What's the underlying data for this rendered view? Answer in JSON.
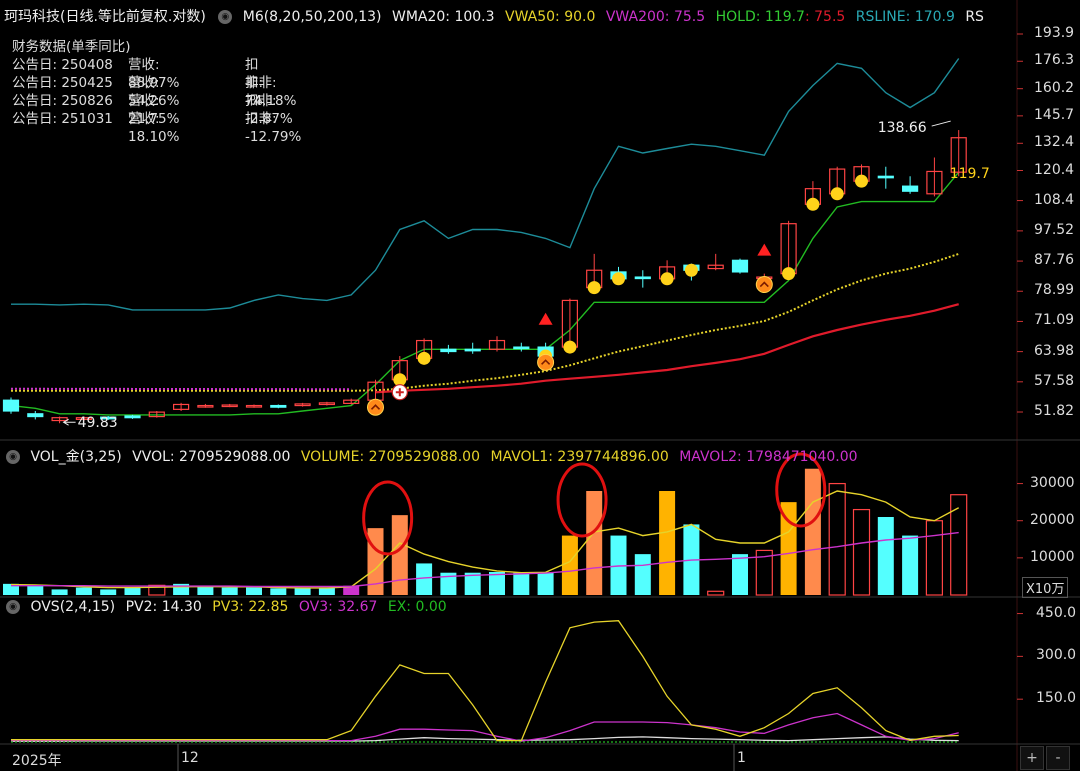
{
  "header": {
    "title": "珂玛科技(日线.等比前复权.对数)",
    "m6": "M6(8,20,50,200,13)",
    "wma20": "WMA20: 100.3",
    "vwa50": "VWA50: 90.0",
    "vwa200": "VWA200: 75.5",
    "hold_a": "HOLD: 119.7",
    "hold_b": ": 75.5",
    "rsline": "RSLINE: 170.9",
    "rs": "RS"
  },
  "financials": {
    "title": "财务数据(单季同比)",
    "rows": [
      {
        "date": "公告日: 250408",
        "rev": "营收: 88.97%",
        "np": "扣非: -%"
      },
      {
        "date": "公告日: 250425",
        "rev": "营收: 54.26%",
        "np": "扣非: 74.18%"
      },
      {
        "date": "公告日: 250826",
        "rev": "营收: 21.75%",
        "np": "扣非: -2.87%"
      },
      {
        "date": "公告日: 251031",
        "rev": "营收: 18.10%",
        "np": "扣非: -12.79%"
      }
    ]
  },
  "price_axis": [
    "193.9",
    "176.3",
    "160.2",
    "145.7",
    "132.4",
    "120.4",
    "108.4",
    "97.52",
    "87.76",
    "78.99",
    "71.09",
    "63.98",
    "57.58",
    "51.82"
  ],
  "annotations": {
    "high": "138.66",
    "low": "49.83",
    "last": "119.7"
  },
  "volume_panel": {
    "name": "VOL_金(3,25)",
    "vvol": "VVOL: 2709529088.00",
    "volume": "VOLUME: 2709529088.00",
    "mavol1": "MAVOL1: 2397744896.00",
    "mavol2": "MAVOL2: 1798471040.00",
    "axis": [
      "30000",
      "20000",
      "10000"
    ],
    "unit": "X10万"
  },
  "ovs_panel": {
    "name": "OVS(2,4,15)",
    "pv2": "PV2: 14.30",
    "pv3": "PV3: 22.85",
    "ov3": "OV3: 32.67",
    "ex": "EX: 0.00",
    "axis": [
      "450.0",
      "300.0",
      "150.0"
    ]
  },
  "time_axis": [
    "2025年",
    "12",
    "1"
  ],
  "buttons": {
    "plus": "+",
    "minus": "-"
  },
  "colors": {
    "up": "#ff4444",
    "down": "#54ffff",
    "yellow": "#e6d32a",
    "magenta": "#cc33cc",
    "green": "#22bb22",
    "teal": "#1d8c99",
    "red_line": "#e01b2b",
    "orange": "#ff8a4c",
    "gold": "#ffb300"
  },
  "chart_data": [
    {
      "type": "candlestick",
      "title": "珂玛科技(日线.等比前复权.对数)",
      "y_scale": "log",
      "ylim": [
        49.83,
        193.9
      ],
      "candles": [
        {
          "o": 52,
          "c": 54,
          "h": 54.5,
          "l": 51.5,
          "dir": "down"
        },
        {
          "o": 51,
          "c": 51.5,
          "h": 52,
          "l": 50.5,
          "dir": "down"
        },
        {
          "o": 50.3,
          "c": 50.8,
          "h": 51,
          "l": 49.83,
          "dir": "up"
        },
        {
          "o": 50.5,
          "c": 50.8,
          "h": 51,
          "l": 50.2,
          "dir": "up"
        },
        {
          "o": 50.6,
          "c": 50.9,
          "h": 51.1,
          "l": 50.4,
          "dir": "down"
        },
        {
          "o": 50.8,
          "c": 51.1,
          "h": 51.3,
          "l": 50.6,
          "dir": "down"
        },
        {
          "o": 51,
          "c": 51.8,
          "h": 52,
          "l": 50.8,
          "dir": "up"
        },
        {
          "o": 52.3,
          "c": 53.2,
          "h": 53.5,
          "l": 52,
          "dir": "up"
        },
        {
          "o": 52.8,
          "c": 53,
          "h": 53.3,
          "l": 52.6,
          "dir": "up"
        },
        {
          "o": 52.9,
          "c": 53.1,
          "h": 53.3,
          "l": 52.7,
          "dir": "up"
        },
        {
          "o": 53,
          "c": 52.8,
          "h": 53.2,
          "l": 52.6,
          "dir": "up"
        },
        {
          "o": 53,
          "c": 52.7,
          "h": 53.2,
          "l": 52.5,
          "dir": "down"
        },
        {
          "o": 53,
          "c": 53.3,
          "h": 53.5,
          "l": 52.8,
          "dir": "up"
        },
        {
          "o": 53.2,
          "c": 53.5,
          "h": 53.7,
          "l": 53,
          "dir": "up"
        },
        {
          "o": 53.4,
          "c": 54,
          "h": 54.3,
          "l": 53.2,
          "dir": "up"
        },
        {
          "o": 54,
          "c": 57.5,
          "h": 58,
          "l": 53.8,
          "dir": "up"
        },
        {
          "o": 58,
          "c": 62,
          "h": 63,
          "l": 57.5,
          "dir": "up"
        },
        {
          "o": 62.5,
          "c": 66.5,
          "h": 67,
          "l": 62,
          "dir": "up"
        },
        {
          "o": 64.5,
          "c": 64,
          "h": 65.5,
          "l": 63.5,
          "dir": "down"
        },
        {
          "o": 64.5,
          "c": 64.5,
          "h": 66,
          "l": 63.5,
          "dir": "down"
        },
        {
          "o": 64.5,
          "c": 66.5,
          "h": 67.5,
          "l": 64,
          "dir": "up"
        },
        {
          "o": 65,
          "c": 65,
          "h": 66,
          "l": 64,
          "dir": "down"
        },
        {
          "o": 65,
          "c": 63,
          "h": 66,
          "l": 62.5,
          "dir": "down"
        },
        {
          "o": 65,
          "c": 76.5,
          "h": 77,
          "l": 64.5,
          "dir": "up"
        },
        {
          "o": 80,
          "c": 85,
          "h": 90,
          "l": 79,
          "dir": "up"
        },
        {
          "o": 84.5,
          "c": 82.5,
          "h": 86,
          "l": 82,
          "dir": "down"
        },
        {
          "o": 83,
          "c": 82.8,
          "h": 85,
          "l": 80,
          "dir": "down"
        },
        {
          "o": 82.5,
          "c": 86,
          "h": 88,
          "l": 81,
          "dir": "up"
        },
        {
          "o": 85,
          "c": 86.5,
          "h": 87,
          "l": 82,
          "dir": "down"
        },
        {
          "o": 85.5,
          "c": 86.5,
          "h": 90,
          "l": 85,
          "dir": "up"
        },
        {
          "o": 88,
          "c": 84.5,
          "h": 88.5,
          "l": 84,
          "dir": "down"
        },
        {
          "o": 83,
          "c": 83,
          "h": 84,
          "l": 82,
          "dir": "up"
        },
        {
          "o": 84,
          "c": 100,
          "h": 101,
          "l": 83,
          "dir": "up"
        },
        {
          "o": 107,
          "c": 113,
          "h": 116,
          "l": 106,
          "dir": "up"
        },
        {
          "o": 111,
          "c": 121,
          "h": 122,
          "l": 110,
          "dir": "up"
        },
        {
          "o": 116,
          "c": 122,
          "h": 123,
          "l": 114,
          "dir": "up"
        },
        {
          "o": 118,
          "c": 118,
          "h": 122,
          "l": 113,
          "dir": "down"
        },
        {
          "o": 114,
          "c": 112,
          "h": 118,
          "l": 111,
          "dir": "down"
        },
        {
          "o": 111,
          "c": 120,
          "h": 126,
          "l": 110,
          "dir": "up"
        },
        {
          "o": 119.7,
          "c": 135,
          "h": 138.66,
          "l": 118,
          "dir": "up"
        }
      ],
      "series": [
        {
          "name": "RSLINE",
          "values": [
            75.5,
            75.5,
            75.3,
            75.5,
            75.3,
            74,
            74,
            74,
            74,
            74.5,
            76.5,
            78,
            77,
            76.5,
            78,
            85,
            98,
            101,
            95,
            98,
            98,
            97,
            95,
            92,
            113,
            131,
            128,
            130,
            132,
            131,
            129,
            127,
            148,
            162,
            175,
            172,
            158,
            150,
            158,
            178
          ]
        },
        {
          "name": "HOLD",
          "values": [
            53,
            52.5,
            51.5,
            51.5,
            51.3,
            51.3,
            51.3,
            51.3,
            51.3,
            51.3,
            51.5,
            51.5,
            52,
            52.5,
            53,
            57,
            62,
            64.5,
            64.5,
            64.5,
            64.5,
            64.5,
            64.5,
            69,
            76,
            76,
            76,
            76,
            76,
            76,
            76,
            76,
            82,
            95,
            106,
            108,
            108,
            108,
            108,
            119.7
          ]
        },
        {
          "name": "VWA50",
          "values": [
            55.8,
            55.8,
            55.8,
            55.8,
            55.8,
            55.8,
            55.8,
            55.8,
            55.8,
            55.8,
            55.8,
            55.8,
            55.8,
            55.8,
            55.8,
            55.9,
            56.2,
            56.8,
            57.2,
            57.8,
            58.3,
            59,
            59.8,
            61,
            62.5,
            64,
            65.2,
            66.5,
            67.8,
            69,
            70,
            71.2,
            73.5,
            76.5,
            79.5,
            82,
            84,
            85.5,
            87.5,
            90
          ]
        },
        {
          "name": "VWA200",
          "values": [
            null,
            null,
            null,
            null,
            null,
            null,
            null,
            null,
            null,
            null,
            null,
            null,
            null,
            null,
            null,
            55.5,
            55.8,
            56,
            56.2,
            56.5,
            56.8,
            57.2,
            57.8,
            58.2,
            58.6,
            59,
            59.5,
            60,
            60.8,
            61.5,
            62.3,
            63.5,
            65.5,
            67.5,
            69,
            70.3,
            71.5,
            72.5,
            73.8,
            75.5
          ]
        }
      ],
      "markers": {
        "dots_at": [
          16,
          17,
          22,
          23,
          24,
          25,
          27,
          28,
          32,
          33,
          34,
          35
        ],
        "up_triangles_at": [
          22,
          31
        ],
        "cross_at": [
          16
        ],
        "chevron_at": [
          15,
          22,
          31
        ]
      }
    },
    {
      "type": "bar",
      "title": "VOL_金(3,25)",
      "unit": "X10万",
      "ylim": [
        0,
        35000
      ],
      "values": [
        3000,
        2500,
        1500,
        2000,
        1500,
        2000,
        2600,
        3000,
        2200,
        2000,
        2000,
        1800,
        1800,
        2000,
        2500,
        18000,
        21500,
        8500,
        6000,
        6000,
        6200,
        6000,
        6000,
        16000,
        28000,
        16000,
        11000,
        28000,
        19000,
        1000,
        11000,
        12000,
        25000,
        34000,
        30000,
        23000,
        21000,
        16000,
        20000,
        27000
      ],
      "styles": [
        "cyan",
        "cyan",
        "cyan",
        "cyan",
        "cyan",
        "cyan",
        "red",
        "cyan",
        "cyan",
        "cyan",
        "cyan",
        "cyan",
        "cyan",
        "cyan",
        "magenta",
        "orange",
        "orange",
        "cyan",
        "cyan",
        "cyan",
        "cyan",
        "cyan",
        "cyan",
        "gold",
        "orange",
        "cyan",
        "cyan",
        "gold",
        "cyan",
        "red",
        "cyan",
        "red",
        "gold",
        "orange",
        "red",
        "red",
        "cyan",
        "cyan",
        "red",
        "red"
      ],
      "series": [
        {
          "name": "MAVOL1",
          "values": [
            2800,
            2700,
            2500,
            2200,
            2000,
            2000,
            2100,
            2200,
            2300,
            2200,
            2200,
            2000,
            1900,
            1900,
            2200,
            7000,
            14000,
            11000,
            9000,
            7500,
            6500,
            6000,
            6100,
            9000,
            17000,
            18000,
            16000,
            17000,
            19000,
            15000,
            14000,
            14000,
            17000,
            25000,
            28000,
            27000,
            25000,
            21000,
            20000,
            23500
          ]
        },
        {
          "name": "MAVOL2",
          "values": [
            2500,
            2500,
            2500,
            2500,
            2400,
            2400,
            2400,
            2400,
            2400,
            2400,
            2300,
            2300,
            2300,
            2300,
            2300,
            3000,
            4000,
            4600,
            5000,
            5300,
            5500,
            5700,
            5900,
            6400,
            7300,
            7800,
            8000,
            8800,
            9400,
            9600,
            9900,
            10300,
            11200,
            12200,
            13000,
            14000,
            14800,
            15300,
            16000,
            16800
          ]
        }
      ],
      "highlight_circles_at": [
        15.5,
        23.5,
        32.5
      ]
    },
    {
      "type": "line",
      "title": "OVS(2,4,15)",
      "ylim": [
        0,
        480
      ],
      "series": [
        {
          "name": "PV3",
          "values": [
            2,
            2,
            2,
            3,
            3,
            3,
            3,
            3,
            3,
            3,
            3,
            3,
            3,
            3,
            3,
            5,
            10,
            15,
            12,
            10,
            8,
            6,
            7,
            8,
            12,
            16,
            18,
            15,
            12,
            10,
            8,
            6,
            5,
            8,
            12,
            15,
            18,
            10,
            6,
            5
          ]
        },
        {
          "name": "OV3",
          "values": [
            5,
            5,
            5,
            5,
            5,
            5,
            5,
            5,
            5,
            5,
            5,
            5,
            5,
            5,
            5,
            20,
            45,
            45,
            42,
            40,
            20,
            3,
            15,
            40,
            70,
            70,
            70,
            68,
            60,
            50,
            35,
            30,
            60,
            85,
            100,
            60,
            20,
            6,
            12,
            32.67
          ]
        },
        {
          "name": "YELLOW",
          "values": [
            8,
            8,
            8,
            8,
            8,
            8,
            8,
            8,
            8,
            8,
            8,
            8,
            8,
            8,
            40,
            160,
            270,
            240,
            240,
            130,
            5,
            5,
            210,
            400,
            420,
            425,
            300,
            160,
            60,
            45,
            20,
            50,
            100,
            170,
            190,
            120,
            40,
            6,
            20,
            22.85
          ]
        },
        {
          "name": "EX",
          "values": [
            0,
            0,
            0,
            0,
            0,
            0,
            0,
            0,
            0,
            0,
            0,
            0,
            0,
            0,
            0,
            0,
            0,
            0,
            0,
            0,
            0,
            0,
            0,
            0,
            0,
            0,
            0,
            0,
            0,
            0,
            0,
            0,
            0,
            0,
            0,
            0,
            0,
            0,
            0,
            0
          ]
        }
      ]
    }
  ]
}
